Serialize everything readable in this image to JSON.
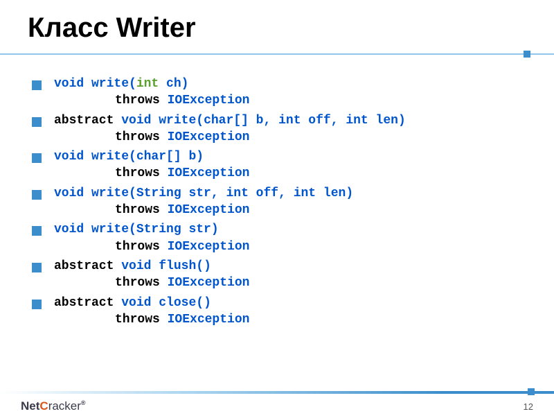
{
  "title": "Класс Writer",
  "methods": [
    {
      "abstract": false,
      "name": "write",
      "params": [
        {
          "type": "int",
          "green": true,
          "name": "ch"
        }
      ]
    },
    {
      "abstract": true,
      "name": "write",
      "params": [
        {
          "type": "char[]",
          "name": "b"
        },
        {
          "type": "int",
          "name": "off"
        },
        {
          "type": "int",
          "name": "len"
        }
      ]
    },
    {
      "abstract": false,
      "name": "write",
      "params": [
        {
          "type": "char[]",
          "name": "b"
        }
      ]
    },
    {
      "abstract": false,
      "name": "write",
      "params": [
        {
          "type": "String",
          "name": "str"
        },
        {
          "type": "int",
          "name": "off"
        },
        {
          "type": "int",
          "name": "len"
        }
      ]
    },
    {
      "abstract": false,
      "name": "write",
      "params": [
        {
          "type": "String",
          "name": "str"
        }
      ]
    },
    {
      "abstract": true,
      "name": "flush",
      "params": []
    },
    {
      "abstract": true,
      "name": "close",
      "params": []
    }
  ],
  "throws_kw": "throws",
  "exception": "IOException",
  "void_kw": "void",
  "abstract_kw": "abstract",
  "footer": {
    "logo_net": "Net",
    "logo_c": "C",
    "logo_racker": "racker",
    "reg": "®",
    "page": "12"
  }
}
